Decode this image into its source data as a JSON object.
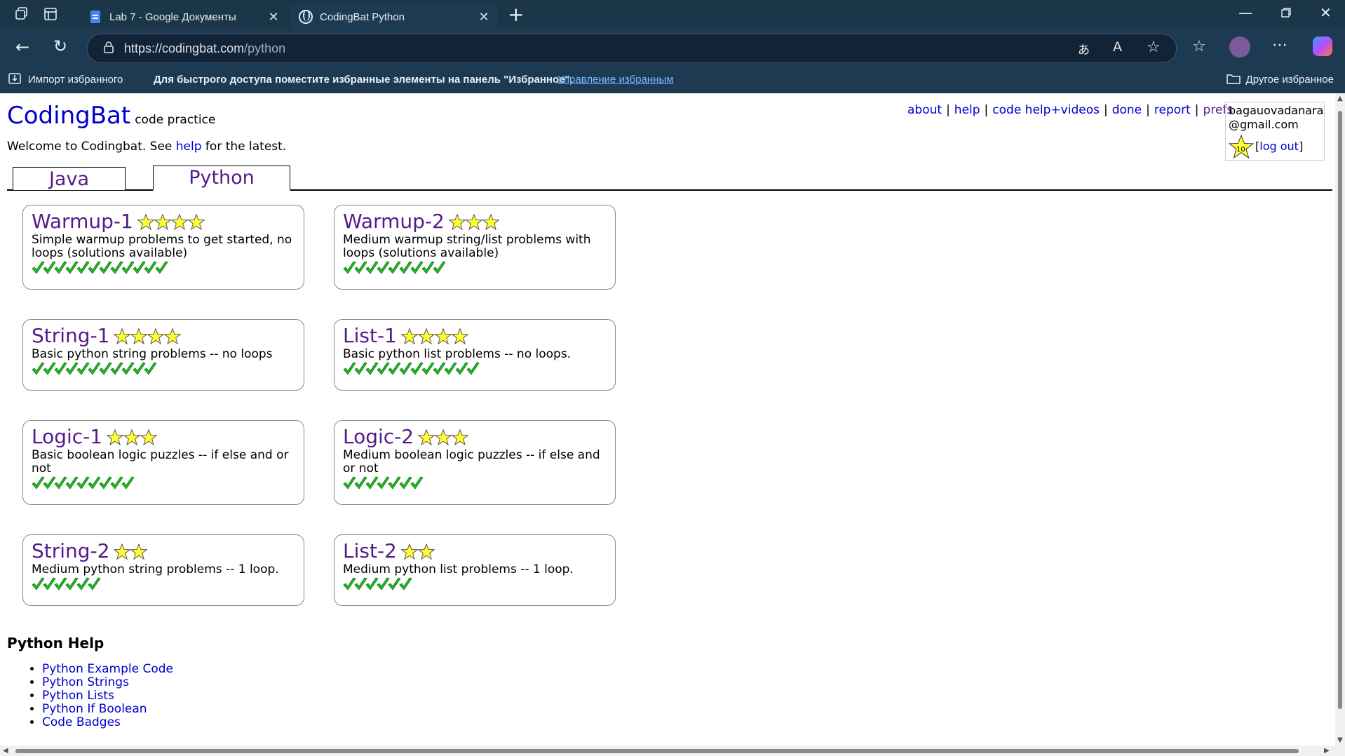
{
  "browser": {
    "tabs": [
      {
        "title": "Lab 7 - Google Документы",
        "icon": "google-docs-icon"
      },
      {
        "title": "CodingBat Python",
        "icon": "globe-icon"
      }
    ],
    "address": {
      "host": "https://codingbat.com",
      "path": "/python"
    },
    "favorites_bar": {
      "import_label": "Импорт избранного",
      "message": "Для быстрого доступа поместите избранные элементы на панель \"Избранное\".",
      "manage_label": "Управление избранным",
      "other_label": "Другое избранное"
    }
  },
  "site": {
    "logo": "CodingBat",
    "tagline": "code practice",
    "nav": [
      "about",
      "help",
      "code help+videos",
      "done",
      "report",
      "prefs"
    ],
    "user": {
      "email_line1": "bagauovadanara",
      "email_line2": "@gmail.com",
      "badge_count": "10",
      "logout": "log out"
    },
    "welcome": {
      "before": "Welcome to Codingbat. See ",
      "link": "help",
      "after": " for the latest."
    },
    "lang_tabs": [
      "Java",
      "Python"
    ]
  },
  "sections": [
    {
      "title": "Warmup-1",
      "stars": 4,
      "desc": "Simple warmup problems to get started, no loops (solutions available)",
      "checks": 12
    },
    {
      "title": "Warmup-2",
      "stars": 3,
      "desc": "Medium warmup string/list problems with loops (solutions available)",
      "checks": 9
    },
    {
      "title": "String-1",
      "stars": 4,
      "desc": "Basic python string problems -- no loops",
      "checks": 11
    },
    {
      "title": "List-1",
      "stars": 4,
      "desc": "Basic python list problems -- no loops.",
      "checks": 12
    },
    {
      "title": "Logic-1",
      "stars": 3,
      "desc": "Basic boolean logic puzzles -- if else and or not",
      "checks": 9
    },
    {
      "title": "Logic-2",
      "stars": 3,
      "desc": "Medium boolean logic puzzles -- if else and or not",
      "checks": 7
    },
    {
      "title": "String-2",
      "stars": 2,
      "desc": "Medium python string problems -- 1 loop.",
      "checks": 6
    },
    {
      "title": "List-2",
      "stars": 2,
      "desc": "Medium python list problems -- 1 loop.",
      "checks": 6
    }
  ],
  "python_help": {
    "heading": "Python Help",
    "links": [
      "Python Example Code",
      "Python Strings",
      "Python Lists",
      "Python If Boolean",
      "Code Badges"
    ]
  },
  "colors": {
    "chrome": "#1e3a53",
    "link": "#0000cc",
    "visited": "#551a8b",
    "check": "#22bb22",
    "star": "#ffff33"
  }
}
